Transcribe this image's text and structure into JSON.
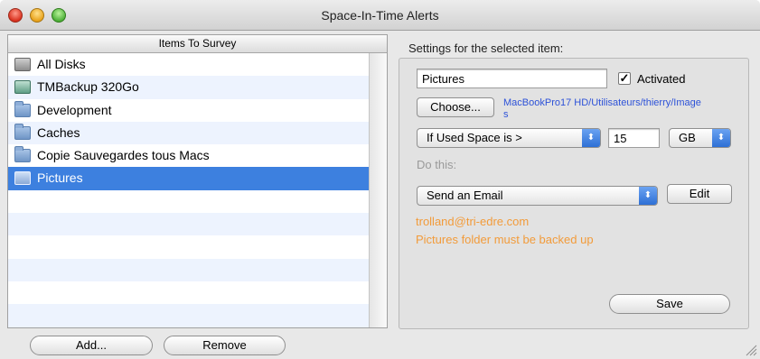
{
  "window": {
    "title": "Space-In-Time Alerts"
  },
  "list": {
    "header": "Items To Survey",
    "items": [
      {
        "label": "All Disks",
        "icon": "disk-icon",
        "selected": false
      },
      {
        "label": "TMBackup 320Go",
        "icon": "time-machine-drive-icon",
        "selected": false
      },
      {
        "label": "Development",
        "icon": "folder-icon",
        "selected": false
      },
      {
        "label": "Caches",
        "icon": "folder-icon",
        "selected": false
      },
      {
        "label": "Copie Sauvegardes tous Macs",
        "icon": "folder-icon",
        "selected": false
      },
      {
        "label": "Pictures",
        "icon": "pictures-folder-icon",
        "selected": true
      }
    ]
  },
  "buttons": {
    "add": "Add...",
    "remove": "Remove"
  },
  "settings": {
    "heading": "Settings for the selected item:",
    "name_value": "Pictures",
    "activated_label": "Activated",
    "activated": true,
    "checkmark": "✓",
    "choose_label": "Choose...",
    "path_line1": "MacBookPro17 HD/Utilisateurs/thierry/Image",
    "path_line2": "s",
    "condition_selected": "If Used Space is >",
    "threshold_value": "15",
    "unit_selected": "GB",
    "do_this_label": "Do this:",
    "action_selected": "Send an Email",
    "edit_label": "Edit",
    "email": "trolland@tri-edre.com",
    "message": "Pictures folder must be backed up",
    "save_label": "Save",
    "popup_arrows": "⬍"
  },
  "colors": {
    "selection": "#3d80df",
    "accent_text": "#f29b3a",
    "link": "#2d52d8"
  }
}
